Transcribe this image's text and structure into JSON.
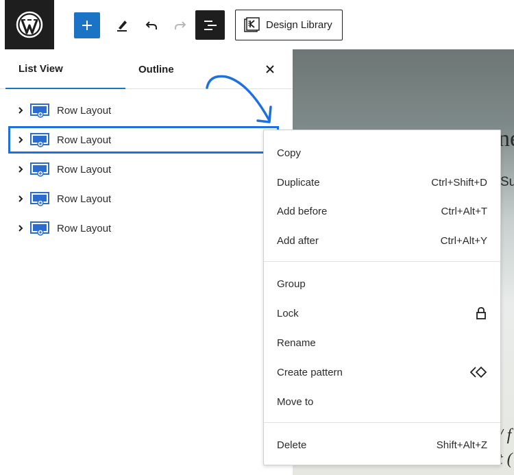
{
  "toolbar": {
    "design_library_label": "Design Library",
    "icons": {
      "logo": "wordpress-logo-icon",
      "add": "plus-icon",
      "edit": "pencil-icon",
      "undo": "undo-icon",
      "redo": "redo-icon",
      "list_view": "list-view-icon",
      "design_library": "kadence-icon"
    },
    "accent_color": "#1a73c4"
  },
  "panel": {
    "tabs": [
      {
        "label": "List View",
        "active": true
      },
      {
        "label": "Outline",
        "active": false
      }
    ],
    "close_icon": "close-icon",
    "rows": [
      {
        "label": "Row Layout",
        "selected": false
      },
      {
        "label": "Row Layout",
        "selected": true
      },
      {
        "label": "Row Layout",
        "selected": false
      },
      {
        "label": "Row Layout",
        "selected": false
      },
      {
        "label": "Row Layout",
        "selected": false
      }
    ],
    "highlight_color": "#1e6fe0"
  },
  "canvas": {
    "fragments": [
      "ne",
      "Su",
      "/ f",
      "t ("
    ]
  },
  "context_menu": {
    "groups": [
      [
        {
          "label": "Copy",
          "shortcut": ""
        },
        {
          "label": "Duplicate",
          "shortcut": "Ctrl+Shift+D"
        },
        {
          "label": "Add before",
          "shortcut": "Ctrl+Alt+T"
        },
        {
          "label": "Add after",
          "shortcut": "Ctrl+Alt+Y"
        }
      ],
      [
        {
          "label": "Group",
          "shortcut": ""
        },
        {
          "label": "Lock",
          "shortcut": "",
          "icon": "lock-icon"
        },
        {
          "label": "Rename",
          "shortcut": ""
        },
        {
          "label": "Create pattern",
          "shortcut": "",
          "icon": "pattern-icon"
        },
        {
          "label": "Move to",
          "shortcut": ""
        }
      ],
      [
        {
          "label": "Delete",
          "shortcut": "Shift+Alt+Z"
        }
      ]
    ]
  }
}
